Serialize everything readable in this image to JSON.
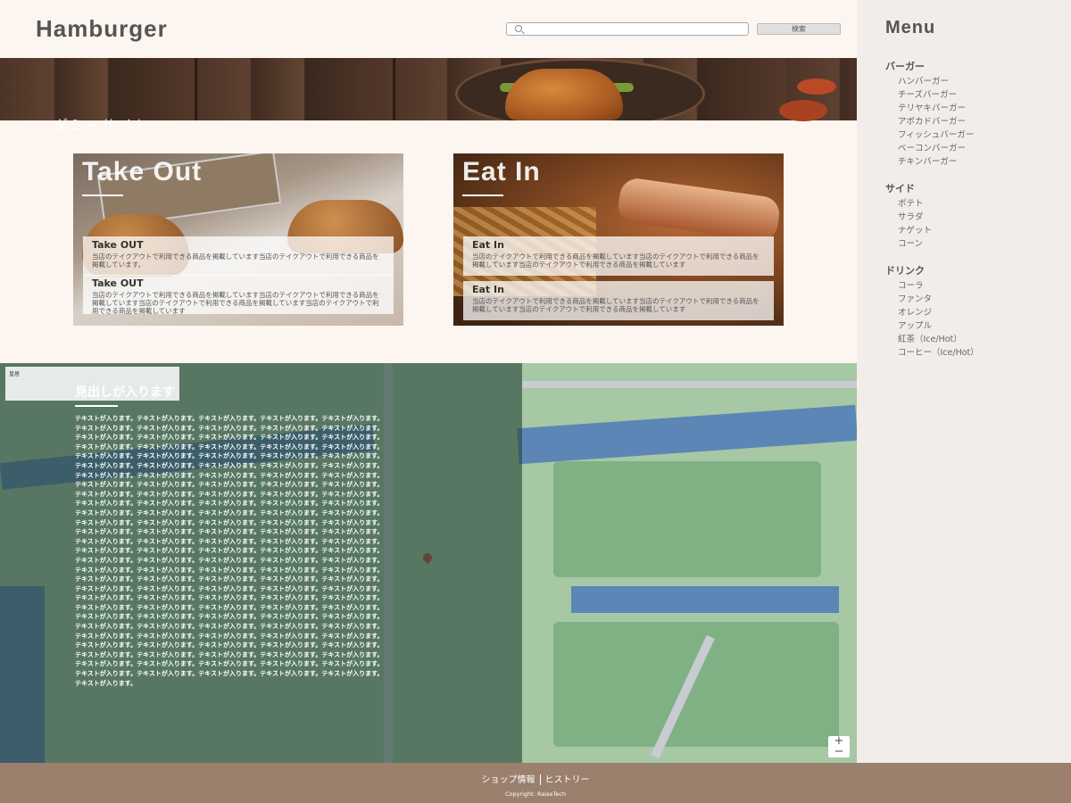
{
  "header": {
    "logo": "Hamburger",
    "search_placeholder": "",
    "search_button": "検索"
  },
  "hero": {
    "caption": "ダミーサイト"
  },
  "cards": [
    {
      "title": "Take Out",
      "boxes": [
        {
          "title": "Take OUT",
          "text": "当店のテイクアウトで利用できる商品を掲載しています当店のテイクアウトで利用できる商品を掲載しています。"
        },
        {
          "title": "Take OUT",
          "text": "当店のテイクアウトで利用できる商品を掲載しています当店のテイクアウトで利用できる商品を掲載しています当店のテイクアウトで利用できる商品を掲載しています当店のテイクアウトで利用できる商品を掲載しています"
        }
      ]
    },
    {
      "title": "Eat In",
      "boxes": [
        {
          "title": "Eat In",
          "text": "当店のテイクアウトで利用できる商品を掲載しています当店のテイクアウトで利用できる商品を掲載しています当店のテイクアウトで利用できる商品を掲載しています"
        },
        {
          "title": "Eat In",
          "text": "当店のテイクアウトで利用できる商品を掲載しています当店のテイクアウトで利用できる商品を掲載しています当店のテイクアウトで利用できる商品を掲載しています"
        }
      ]
    }
  ],
  "map_section": {
    "heading": "見出しが入ります",
    "body": "テキストが入ります。テキストが入ります。テキストが入ります。テキストが入ります。テキストが入ります。テキストが入ります。テキストが入ります。テキストが入ります。テキストが入ります。テキストが入ります。テキストが入ります。テキストが入ります。テキストが入ります。テキストが入ります。テキストが入ります。テキストが入ります。テキストが入ります。テキストが入ります。テキストが入ります。テキストが入ります。テキストが入ります。テキストが入ります。テキストが入ります。テキストが入ります。テキストが入ります。テキストが入ります。テキストが入ります。テキストが入ります。テキストが入ります。テキストが入ります。テキストが入ります。テキストが入ります。テキストが入ります。テキストが入ります。テキストが入ります。テキストが入ります。テキストが入ります。テキストが入ります。テキストが入ります。テキストが入ります。テキストが入ります。テキストが入ります。テキストが入ります。テキストが入ります。テキストが入ります。テキストが入ります。テキストが入ります。テキストが入ります。テキストが入ります。テキストが入ります。テキストが入ります。テキストが入ります。テキストが入ります。テキストが入ります。テキストが入ります。テキストが入ります。テキストが入ります。テキストが入ります。テキストが入ります。テキストが入ります。テキストが入ります。テキストが入ります。テキストが入ります。テキストが入ります。テキストが入ります。テキストが入ります。テキストが入ります。テキストが入ります。テキストが入ります。テキストが入ります。テキストが入ります。テキストが入ります。テキストが入ります。テキストが入ります。テキストが入ります。テキストが入ります。テキストが入ります。テキストが入ります。テキストが入ります。テキストが入ります。テキストが入ります。テキストが入ります。テキストが入ります。テキストが入ります。テキストが入ります。テキストが入ります。テキストが入ります。テキストが入ります。テキストが入ります。テキストが入ります。テキストが入ります。テキストが入ります。テキストが入ります。テキストが入ります。テキストが入ります。テキストが入ります。テキストが入ります。テキストが入ります。テキストが入ります。テキストが入ります。テキストが入ります。テキストが入ります。テキストが入ります。テキストが入ります。テキストが入ります。テキストが入ります。テキストが入ります。テキストが入ります。テキストが入ります。テキストが入ります。テキストが入ります。テキストが入ります。テキストが入ります。テキストが入ります。テキストが入ります。テキストが入ります。テキストが入ります。テキストが入ります。テキストが入ります。テキストが入ります。テキストが入ります。テキストが入ります。テキストが入ります。テキストが入ります。テキストが入ります。テキストが入ります。テキストが入ります。テキストが入ります。テキストが入ります。テキストが入ります。テキストが入ります。テキストが入ります。テキストが入ります。テキストが入ります。テキストが入ります。テキストが入ります。テキストが入ります。テキストが入ります。テキストが入ります。テキストが入ります。テキストが入ります。",
    "map_info": "皇居",
    "zoom_in": "+",
    "zoom_out": "−"
  },
  "sidebar": {
    "title": "Menu",
    "groups": [
      {
        "title": "バーガー",
        "items": [
          "ハンバーガー",
          "チーズバーガー",
          "テリヤキバーガー",
          "アボカドバーガー",
          "フィッシュバーガー",
          "ベーコンバーガー",
          "チキンバーガー"
        ]
      },
      {
        "title": "サイド",
        "items": [
          "ポテト",
          "サラダ",
          "ナゲット",
          "コーン"
        ]
      },
      {
        "title": "ドリンク",
        "items": [
          "コーラ",
          "ファンタ",
          "オレンジ",
          "アップル",
          "紅茶（Ice/Hot）",
          "コーヒー（Ice/Hot）"
        ]
      }
    ]
  },
  "footer": {
    "link1": "ショップ情報",
    "link2": "ヒストリー",
    "copyright": "Copyright: RaiseTech"
  }
}
